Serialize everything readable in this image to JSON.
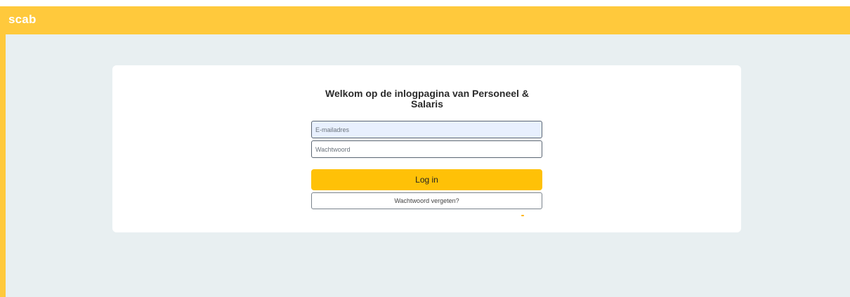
{
  "header": {
    "logo_text": "scab",
    "background_color": "#ffc93c"
  },
  "login": {
    "title": "Welkom op de inlogpagina van Personeel & Salaris",
    "email_placeholder": "E-mailadres",
    "password_placeholder": "Wachtwoord",
    "login_label": "Log in",
    "forgot_label": "Wachtwoord vergeten?"
  },
  "colors": {
    "accent": "#ffc107",
    "page_background": "#e8eff1",
    "card_background": "#ffffff"
  }
}
